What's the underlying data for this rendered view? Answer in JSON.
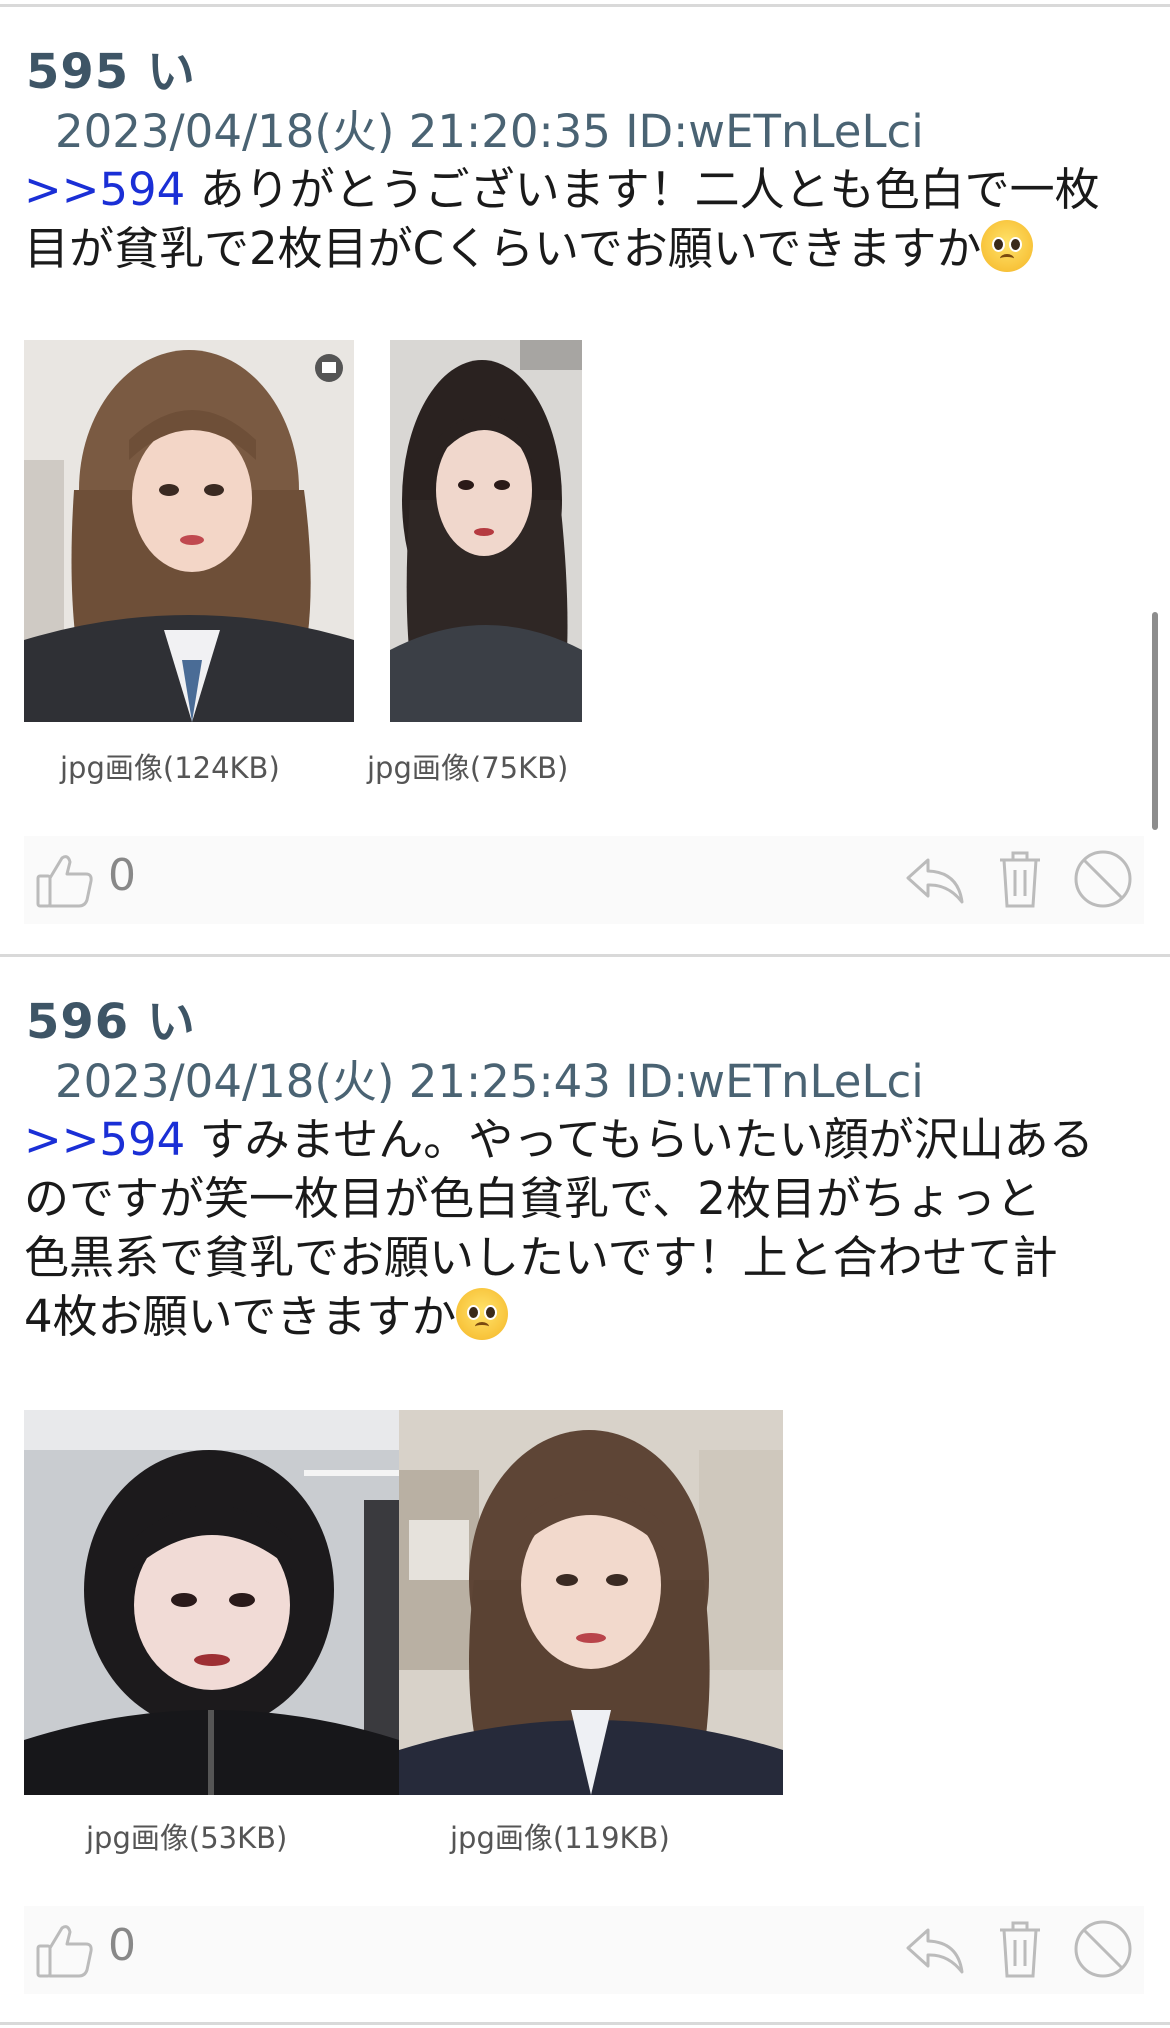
{
  "posts": [
    {
      "number": "595",
      "name": "い",
      "meta": "2023/04/18(火) 21:20:35 ID:wETnLeLci",
      "anchor": ">>594",
      "lines": [
        "ありがとうございます！二人とも色白で一枚",
        "目が貧乳で2枚目がCくらいでお願いできますか"
      ],
      "images": [
        {
          "caption": "jpg画像(124KB)"
        },
        {
          "caption": "jpg画像(75KB)"
        }
      ],
      "likes": "0"
    },
    {
      "number": "596",
      "name": "い",
      "meta": "2023/04/18(火) 21:25:43 ID:wETnLeLci",
      "anchor": ">>594",
      "lines": [
        "すみません。やってもらいたい顔が沢山ある",
        "のですが笑一枚目が色白貧乳で、2枚目がちょっと",
        "色黒系で貧乳でお願いしたいです！上と合わせて計",
        "4枚お願いできますか"
      ],
      "images": [
        {
          "caption": "jpg画像(53KB)"
        },
        {
          "caption": "jpg画像(119KB)"
        }
      ],
      "likes": "0"
    }
  ],
  "icons": {
    "like": "thumbs-up-icon",
    "reply": "reply-icon",
    "delete": "trash-icon",
    "block": "block-icon",
    "emoji": "pleading-face-emoji"
  },
  "colors": {
    "anchor": "#1a2fd6",
    "post_number": "#3e5566",
    "meta": "#4a6373",
    "divider": "#d9d9d9"
  }
}
